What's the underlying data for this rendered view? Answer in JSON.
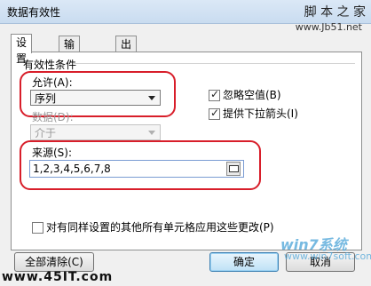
{
  "window": {
    "title": "数据有效性"
  },
  "watermarks": {
    "top_right": "脚 本 之 家",
    "url": "www.Jb51.net",
    "bottom_left": "www.45IT.com",
    "logo": "win7系统",
    "site": "www.win7soft.com"
  },
  "tabs": [
    {
      "label": "设置"
    },
    {
      "label": "输入信息"
    },
    {
      "label": "出错警告"
    }
  ],
  "group": {
    "label": "有效性条件"
  },
  "allow": {
    "label": "允许(A):",
    "value": "序列"
  },
  "data": {
    "label": "数据(D):",
    "value": "介于"
  },
  "checkboxes": {
    "ignore_blank": {
      "label": "忽略空值(B)",
      "checked": true
    },
    "dropdown": {
      "label": "提供下拉箭头(I)",
      "checked": true
    }
  },
  "source": {
    "label": "来源(S):",
    "value": "1,2,3,4,5,6,7,8"
  },
  "apply_all": {
    "label": "对有同样设置的其他所有单元格应用这些更改(P)",
    "checked": false
  },
  "buttons": {
    "clear_all": "全部清除(C)",
    "ok": "确定",
    "cancel": "取消"
  },
  "colors": {
    "highlight": "#d81e2a",
    "titlebar": "#c9dcf0"
  },
  "icons": {
    "check": "✓",
    "range_select": "range-select-icon"
  }
}
